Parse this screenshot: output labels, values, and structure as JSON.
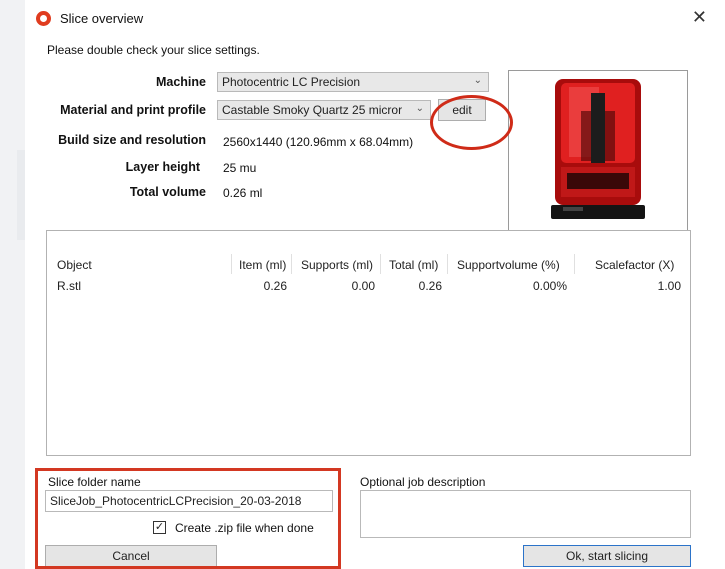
{
  "window": {
    "title": "Slice overview",
    "close_glyph": "✕"
  },
  "instruction": "Please double check your slice settings.",
  "settings": {
    "machine_label": "Machine",
    "machine_value": "Photocentric LC Precision",
    "material_label": "Material and print profile",
    "material_value": "Castable Smoky Quartz 25 micror",
    "edit_button": "edit",
    "build_label": "Build size and resolution",
    "build_value": "2560x1440 (120.96mm x 68.04mm)",
    "layer_label": "Layer height",
    "layer_value": "25 mu",
    "volume_label": "Total volume",
    "volume_value": "0.26 ml"
  },
  "table": {
    "headers": [
      "Object",
      "Item (ml)",
      "Supports (ml)",
      "Total (ml)",
      "Supportvolume (%)",
      "Scalefactor (X)"
    ],
    "rows": [
      [
        "R.stl",
        "0.26",
        "0.00",
        "0.26",
        "0.00%",
        "1.00"
      ]
    ]
  },
  "slice_folder": {
    "label": "Slice folder name",
    "value": "SliceJob_PhotocentricLCPrecision_20-03-2018",
    "zip_label": "Create .zip file when done",
    "zip_checked": true,
    "check_glyph": "✓"
  },
  "job_description": {
    "label": "Optional job description",
    "value": ""
  },
  "buttons": {
    "cancel": "Cancel",
    "ok": "Ok, start slicing"
  },
  "icons": {
    "dropdown": "chevron-down-icon",
    "app": "app-logo-icon",
    "close": "close-icon",
    "check": "checkmark-icon"
  },
  "colors": {
    "annotation_red": "#d33822",
    "printer_red": "#d01414"
  }
}
